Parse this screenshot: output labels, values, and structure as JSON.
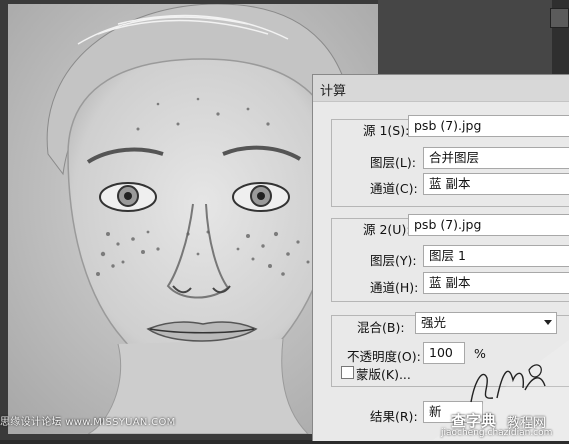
{
  "footer_credit": "思缘设计论坛 www.MISSYUAN.COM",
  "dialog": {
    "title": "计算",
    "source1": {
      "source_label": "源 1(S):",
      "source_value": "psb (7).jpg",
      "layer_label": "图层(L):",
      "layer_value": "合并图层",
      "channel_label": "通道(C):",
      "channel_value": "蓝 副本"
    },
    "source2": {
      "source_label": "源 2(U):",
      "source_value": "psb (7).jpg",
      "layer_label": "图层(Y):",
      "layer_value": "图层 1",
      "channel_label": "通道(H):",
      "channel_value": "蓝 副本"
    },
    "blend": {
      "blend_label": "混合(B):",
      "blend_value": "强光",
      "opacity_label": "不透明度(O):",
      "opacity_value": "100",
      "opacity_unit": "%",
      "mask_label": "蒙版(K)..."
    },
    "result_label": "结果(R):",
    "result_value": "新"
  },
  "watermark": {
    "script_text": "Lan Yue Xin",
    "brand_main": "查字典",
    "brand_sub": "教程网",
    "brand_url": "jiaocheng.chazidian.com"
  }
}
